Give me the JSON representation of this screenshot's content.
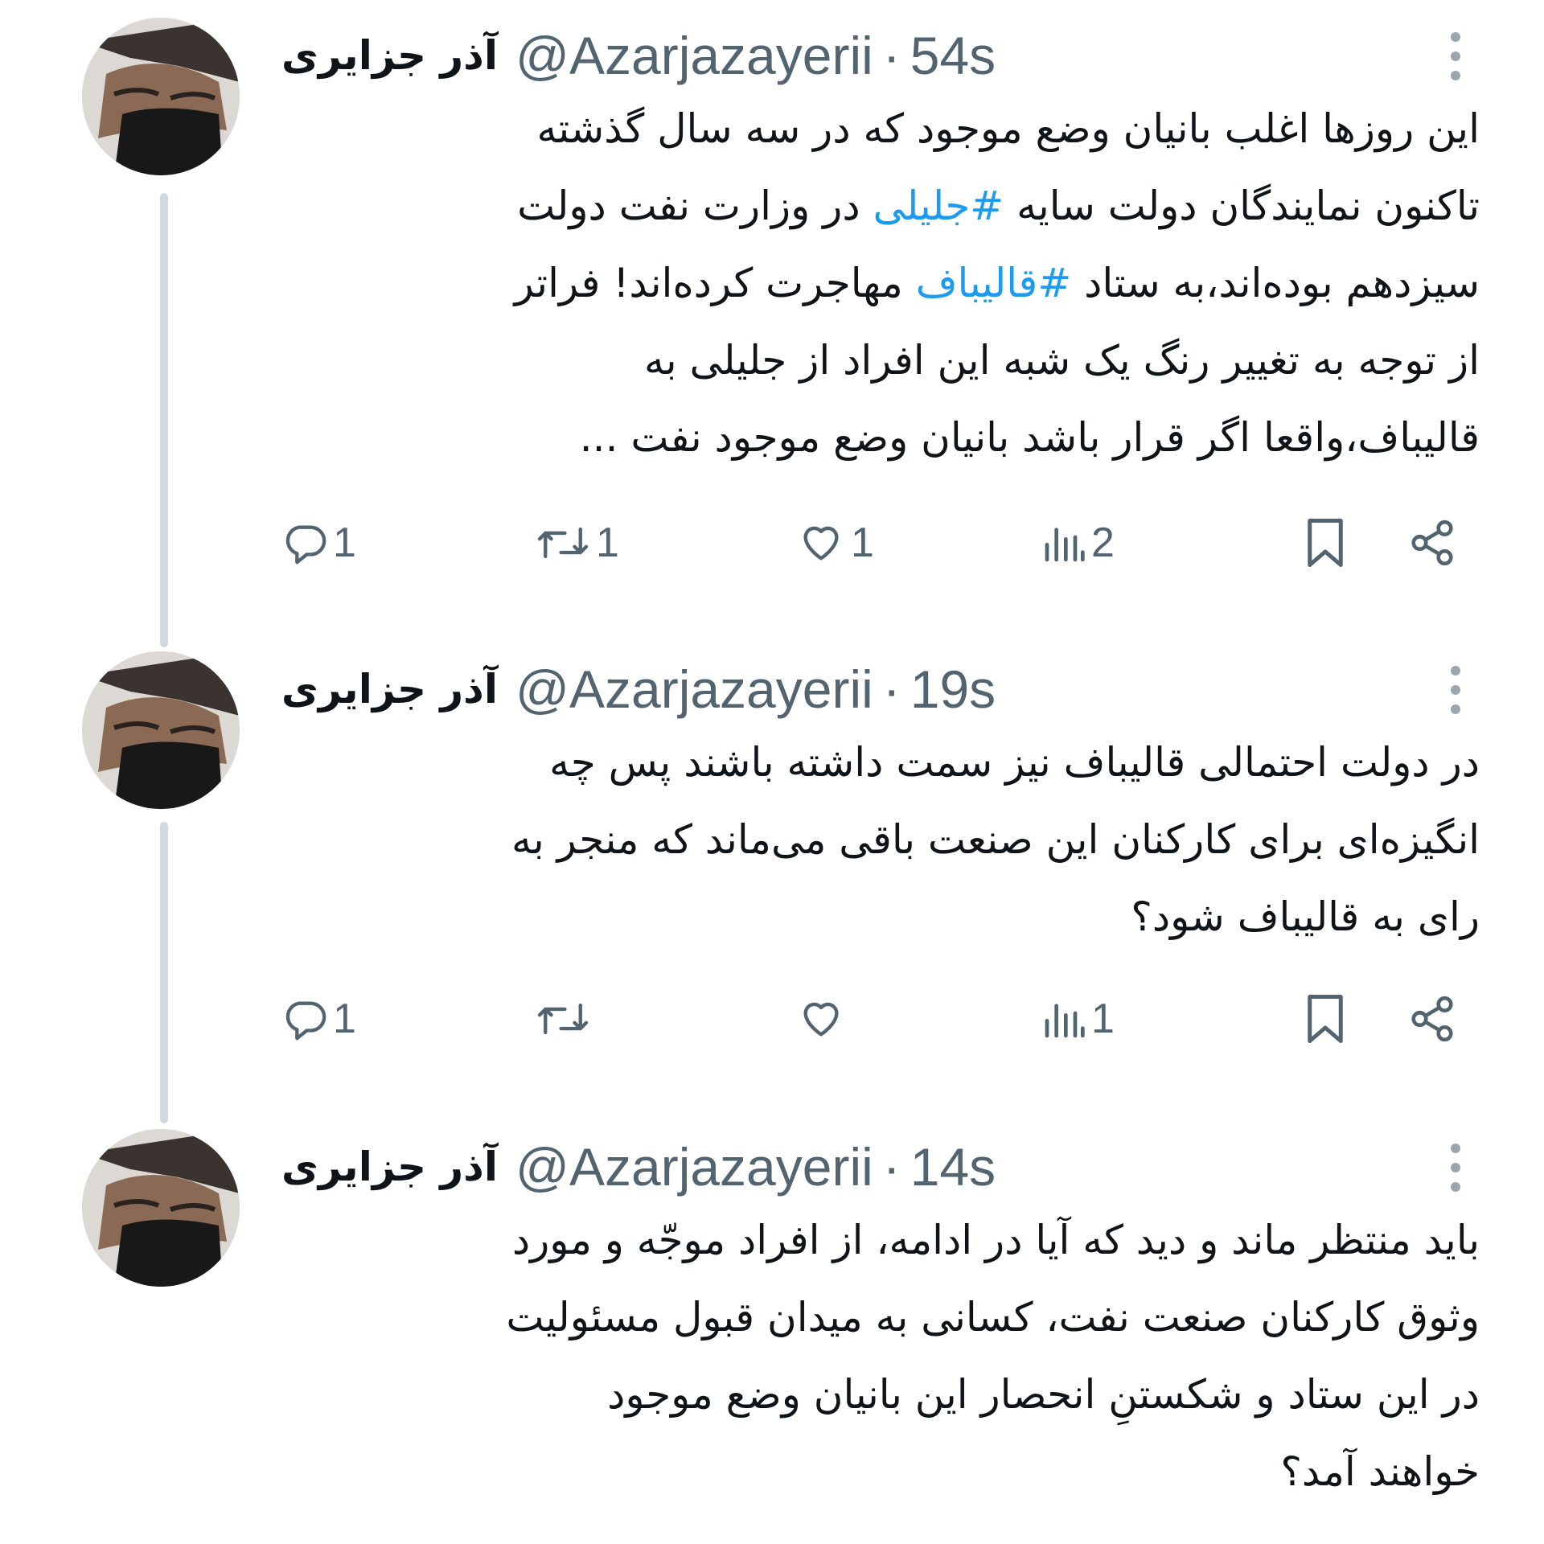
{
  "tweets": [
    {
      "name": "آذر جزایری",
      "handle": "@Azarjazayerii",
      "separator": "·",
      "time": "54s",
      "body_lines": [
        [
          "این روزها اغلب بانیان وضع موجود که در سه سال گذشته"
        ],
        [
          "تاکنون نمایندگان دولت سایه ",
          "#جلیلی",
          " در وزارت نفت دولت"
        ],
        [
          "سیزدهم بوده‌اند،به ستاد ",
          "#قالیباف",
          " مهاجرت کرده‌اند! فراتر"
        ],
        [
          "از توجه به تغییر رنگ یک شبه این افراد از جلیلی به"
        ],
        [
          "قالیباف،واقعا اگر قرار باشد بانیان وضع موجود نفت ..."
        ]
      ],
      "actions": {
        "replies": "1",
        "retweets": "1",
        "likes": "1",
        "views": "2"
      }
    },
    {
      "name": "آذر جزایری",
      "handle": "@Azarjazayerii",
      "separator": "·",
      "time": "19s",
      "body_lines": [
        [
          "در دولت احتمالی قالیباف نیز سمت داشته باشند پس چه"
        ],
        [
          "انگیزه‌ای برای کارکنان این صنعت باقی می‌ماند که منجر به"
        ],
        [
          "رای به قالیباف شود؟"
        ]
      ],
      "actions": {
        "replies": "1",
        "retweets": "",
        "likes": "",
        "views": "1"
      }
    },
    {
      "name": "آذر جزایری",
      "handle": "@Azarjazayerii",
      "separator": "·",
      "time": "14s",
      "body_lines": [
        [
          "باید منتظر ماند و دید که آیا در ادامه، از افراد موجّه و مورد"
        ],
        [
          "وثوق کارکنان صنعت نفت، کسانی به میدان قبول مسئولیت"
        ],
        [
          "در این ستاد و شکستنِ انحصار این بانیان وضع موجود"
        ],
        [
          "خواهند آمد؟"
        ]
      ]
    }
  ],
  "icons": {
    "reply": "reply-icon",
    "retweet": "retweet-icon",
    "like": "heart-icon",
    "views": "views-icon",
    "bookmark": "bookmark-icon",
    "share": "share-icon",
    "more": "more-vertical-icon"
  },
  "colors": {
    "text": "#0f1419",
    "secondary": "#536471",
    "link": "#1d9bf0",
    "thread_line": "#cfd9de"
  }
}
